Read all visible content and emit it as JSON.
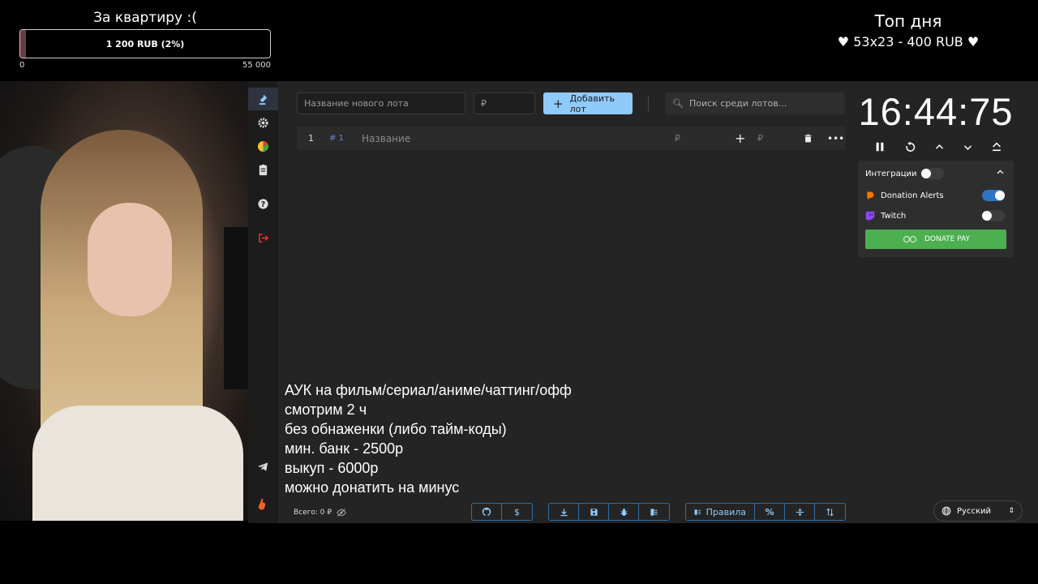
{
  "goal": {
    "title": "За квартиру :(",
    "bar_text": "1 200 RUB (2%)",
    "progress_fraction": 0.022,
    "min": "0",
    "max": "55 000"
  },
  "top_day": {
    "title": "Топ дня",
    "entry": "♥ 53x23 - 400 RUB ♥"
  },
  "sidebar": {
    "items": [
      {
        "icon": "gavel-icon"
      },
      {
        "icon": "gear-icon"
      },
      {
        "icon": "pie-chart-icon"
      },
      {
        "icon": "clipboard-icon"
      },
      {
        "icon": "help-icon"
      },
      {
        "icon": "logout-icon"
      },
      {
        "icon": "telegram-icon"
      },
      {
        "icon": "boosty-icon"
      }
    ]
  },
  "toolbar": {
    "lot_name_placeholder": "Название нового лота",
    "amount_placeholder": "₽",
    "add_label": "Добавить лот",
    "search_placeholder": "Поиск среди лотов..."
  },
  "lot": {
    "index": "1",
    "id": "# 1",
    "name_placeholder": "Название",
    "amount_placeholder": "₽",
    "add_amount_placeholder": "₽"
  },
  "timer": {
    "value": "16:44:75"
  },
  "integrations": {
    "title": "Интеграции",
    "items": [
      {
        "name": "Donation Alerts",
        "enabled": true,
        "color": "#f57507"
      },
      {
        "name": "Twitch",
        "enabled": false,
        "color": "#9146ff"
      }
    ],
    "donate_button": "DONATE PAY"
  },
  "stream_text": {
    "lines": [
      "АУК на фильм/сериал/аниме/чаттинг/офф",
      "смотрим 2 ч",
      "без обнаженки (либо тайм-коды)",
      "мин. банк - 2500р",
      "выкуп - 6000р",
      "можно донатить на минус"
    ]
  },
  "footer": {
    "total": "Всего: 0 ₽",
    "rules_label": "Правила",
    "language": "Русский"
  },
  "colors": {
    "accent": "#90caf9",
    "app_bg": "#242424",
    "sidebar_bg": "#1c1c1c",
    "donate_green": "#4caf50",
    "logout_red": "#e53935",
    "boosty_orange": "#f15f2c"
  }
}
